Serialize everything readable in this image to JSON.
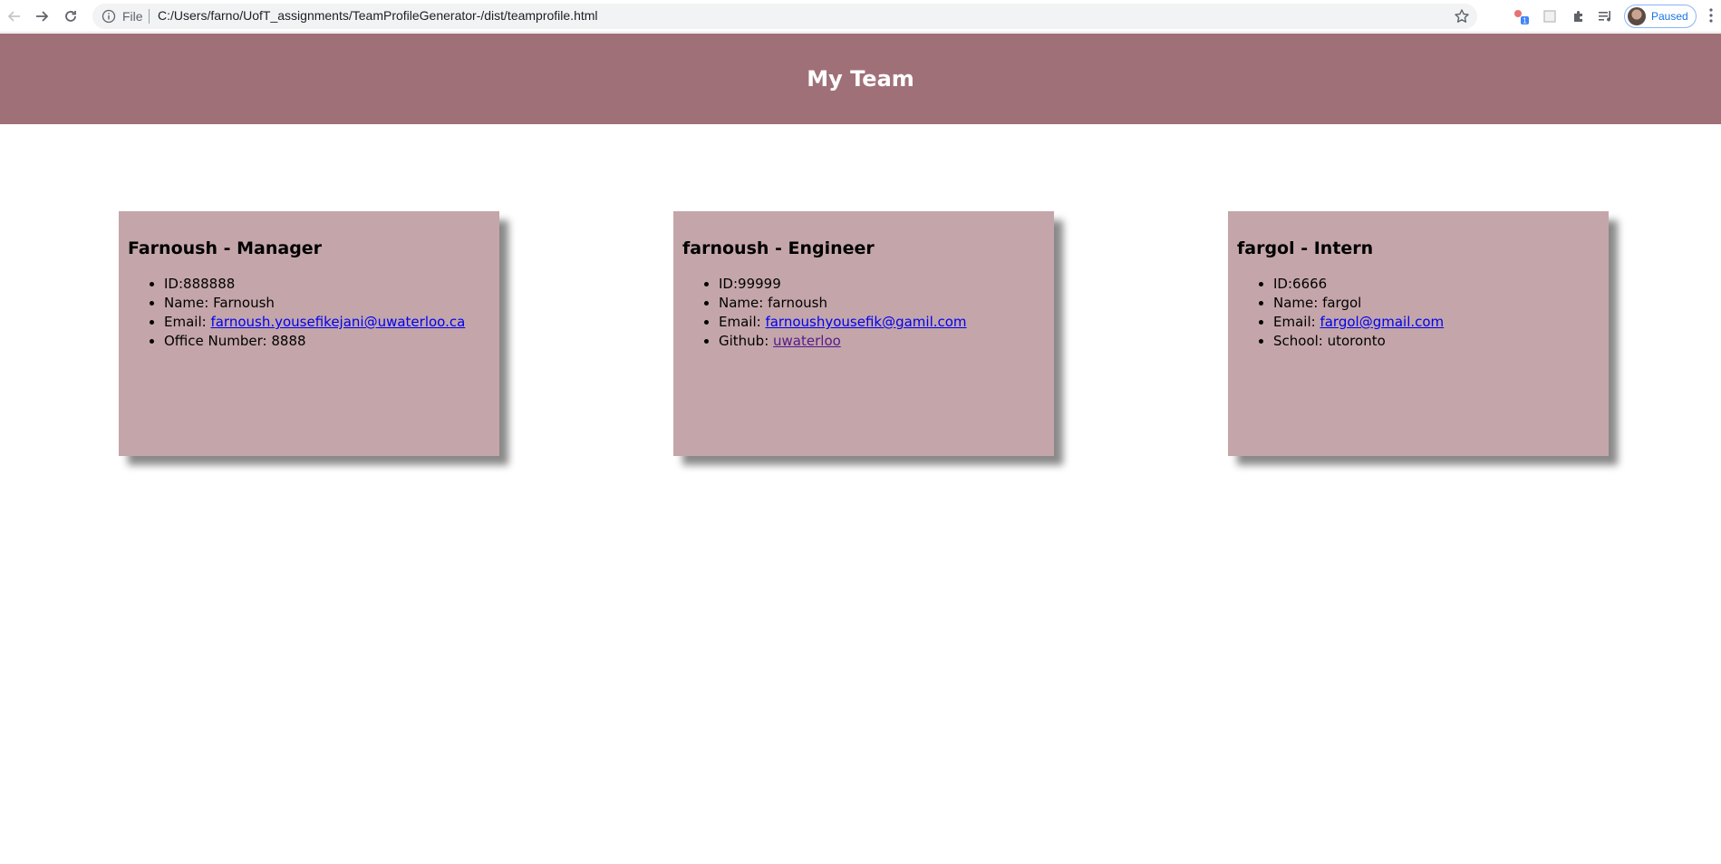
{
  "browser": {
    "scheme_label": "File",
    "url": "C:/Users/farno/UofT_assignments/TeamProfileGenerator-/dist/teamprofile.html",
    "profile_status": "Paused",
    "extension_badge": "1"
  },
  "page": {
    "title": "My Team"
  },
  "team": [
    {
      "heading": "Farnoush - Manager",
      "id_text": "ID:888888",
      "name_text": "Name: Farnoush",
      "email_label": "Email: ",
      "email": "farnoush.yousefikejani@uwaterloo.ca",
      "extra_text": "Office Number: 8888"
    },
    {
      "heading": "farnoush - Engineer",
      "id_text": "ID:99999",
      "name_text": "Name: farnoush",
      "email_label": "Email: ",
      "email": "farnoushyousefik@gamil.com",
      "extra_label": "Github: ",
      "extra_link": "uwaterloo"
    },
    {
      "heading": "fargol - Intern",
      "id_text": "ID:6666",
      "name_text": "Name: fargol",
      "email_label": "Email: ",
      "email": "fargol@gmail.com",
      "extra_text": "School: utoronto"
    }
  ],
  "colors": {
    "header_bg": "#a07078",
    "card_bg": "#c4a6aa",
    "link": "#0000ee",
    "visited_link": "#551a8b"
  }
}
